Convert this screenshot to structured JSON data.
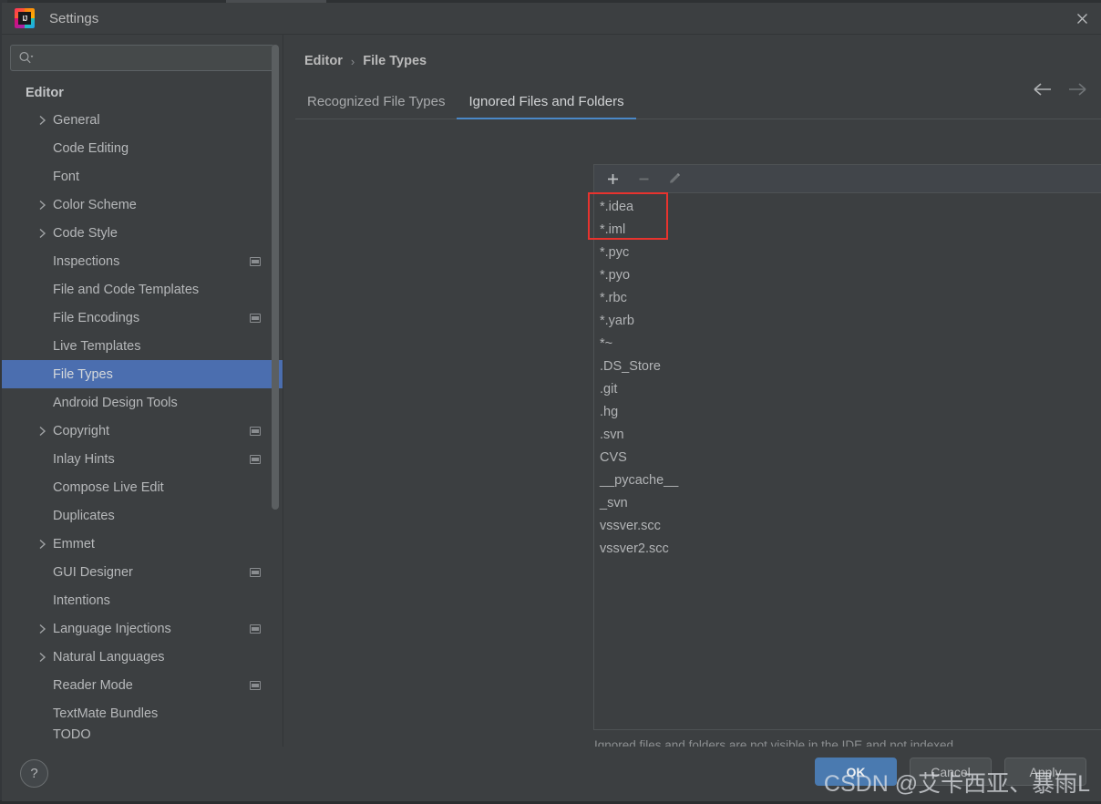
{
  "window": {
    "title": "Settings",
    "logo_icon": "intellij-idea-logo",
    "logo_letters": "IJ",
    "close_icon": "close-icon"
  },
  "search": {
    "placeholder": "",
    "value": "",
    "icon": "search-icon"
  },
  "sidebar": {
    "group_label": "Editor",
    "items": [
      {
        "label": "General",
        "expandable": true,
        "indent": 0,
        "badge": false
      },
      {
        "label": "Code Editing",
        "expandable": false,
        "indent": 0,
        "badge": false
      },
      {
        "label": "Font",
        "expandable": false,
        "indent": 0,
        "badge": false
      },
      {
        "label": "Color Scheme",
        "expandable": true,
        "indent": 0,
        "badge": false
      },
      {
        "label": "Code Style",
        "expandable": true,
        "indent": 0,
        "badge": false
      },
      {
        "label": "Inspections",
        "expandable": false,
        "indent": 0,
        "badge": true
      },
      {
        "label": "File and Code Templates",
        "expandable": false,
        "indent": 0,
        "badge": false
      },
      {
        "label": "File Encodings",
        "expandable": false,
        "indent": 0,
        "badge": true
      },
      {
        "label": "Live Templates",
        "expandable": false,
        "indent": 0,
        "badge": false
      },
      {
        "label": "File Types",
        "expandable": false,
        "indent": 0,
        "badge": false,
        "selected": true
      },
      {
        "label": "Android Design Tools",
        "expandable": false,
        "indent": 0,
        "badge": false
      },
      {
        "label": "Copyright",
        "expandable": true,
        "indent": 0,
        "badge": true
      },
      {
        "label": "Inlay Hints",
        "expandable": false,
        "indent": 0,
        "badge": true
      },
      {
        "label": "Compose Live Edit",
        "expandable": false,
        "indent": 0,
        "badge": false
      },
      {
        "label": "Duplicates",
        "expandable": false,
        "indent": 0,
        "badge": false
      },
      {
        "label": "Emmet",
        "expandable": true,
        "indent": 0,
        "badge": false
      },
      {
        "label": "GUI Designer",
        "expandable": false,
        "indent": 0,
        "badge": true
      },
      {
        "label": "Intentions",
        "expandable": false,
        "indent": 0,
        "badge": false
      },
      {
        "label": "Language Injections",
        "expandable": true,
        "indent": 0,
        "badge": true
      },
      {
        "label": "Natural Languages",
        "expandable": true,
        "indent": 0,
        "badge": false
      },
      {
        "label": "Reader Mode",
        "expandable": false,
        "indent": 0,
        "badge": true
      },
      {
        "label": "TextMate Bundles",
        "expandable": false,
        "indent": 0,
        "badge": false
      },
      {
        "label": "TODO",
        "expandable": false,
        "indent": 0,
        "badge": false,
        "partial": true
      }
    ]
  },
  "main": {
    "breadcrumb": {
      "parent": "Editor",
      "separator": "›",
      "current": "File Types"
    },
    "nav": {
      "back_icon": "arrow-left-icon",
      "forward_icon": "arrow-right-icon"
    },
    "tabs": [
      {
        "label": "Recognized File Types",
        "active": false
      },
      {
        "label": "Ignored Files and Folders",
        "active": true
      }
    ],
    "toolbar": [
      {
        "icon": "add-icon",
        "label": "+",
        "enabled": true
      },
      {
        "icon": "remove-icon",
        "label": "−",
        "enabled": false
      },
      {
        "icon": "edit-pencil-icon",
        "label": "",
        "enabled": false
      }
    ],
    "ignored_entries": [
      "*.idea",
      "*.iml",
      "*.pyc",
      "*.pyo",
      "*.rbc",
      "*.yarb",
      "*~",
      ".DS_Store",
      ".git",
      ".hg",
      ".svn",
      "CVS",
      "__pycache__",
      "_svn",
      "vssver.scc",
      "vssver2.scc"
    ],
    "note": "Ignored files and folders are not visible in the IDE and not indexed"
  },
  "footer": {
    "help_label": "?",
    "buttons": [
      {
        "label": "OK",
        "primary": true
      },
      {
        "label": "Cancel",
        "primary": false
      },
      {
        "label": "Apply",
        "primary": false
      }
    ]
  },
  "watermark": {
    "text": "CSDN @艾卡西亚、暴雨L"
  },
  "colors": {
    "accent": "#4b6eaf",
    "tab_underline": "#4a88c7",
    "annotation": "#e8332e",
    "panel_bg": "#3c3f41"
  }
}
